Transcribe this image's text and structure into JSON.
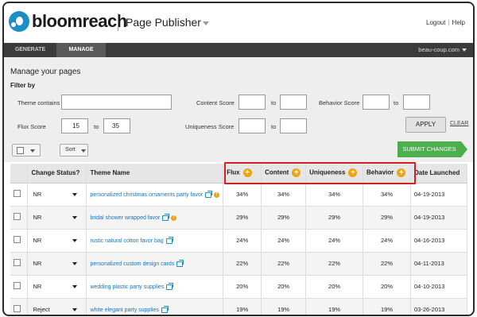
{
  "brand": {
    "name": "bloomreach",
    "app_title": "Page Publisher"
  },
  "toplinks": {
    "logout": "Logout",
    "help": "Help",
    "separator": "|"
  },
  "nav": {
    "tabs": [
      {
        "label": "GENERATE"
      },
      {
        "label": "MANAGE"
      }
    ],
    "site": "beau-coup.com"
  },
  "filter": {
    "heading": "Manage your pages",
    "title": "Filter by",
    "theme_contains": {
      "label": "Theme contains",
      "value": ""
    },
    "content_score": {
      "label": "Content Score",
      "from": "",
      "to": ""
    },
    "behavior_score": {
      "label": "Behavior Score",
      "from": "",
      "to": ""
    },
    "flux_score": {
      "label": "Flux Score",
      "from": "15",
      "to": "35"
    },
    "uniqueness_score": {
      "label": "Uniqueness Score",
      "from": "",
      "to": ""
    },
    "to_label": "to",
    "apply": "APPLY",
    "clear": "CLEAR"
  },
  "toolbar": {
    "sort": "Sort",
    "submit": "SUBMIT CHANGES"
  },
  "table": {
    "headers": {
      "change_status": "Change Status?",
      "theme_name": "Theme Name",
      "flux": "Flux",
      "content": "Content",
      "uniqueness": "Uniqueness",
      "behavior": "Behavior",
      "date_launched": "Date Launched"
    },
    "rows": [
      {
        "status": "NR",
        "theme": "personalized christmas ornaments party favor",
        "warn": true,
        "flux": "34%",
        "content": "34%",
        "uniqueness": "34%",
        "behavior": "34%",
        "date": "04-19-2013"
      },
      {
        "status": "NR",
        "theme": "bridal shower wrapped favor",
        "warn": true,
        "flux": "29%",
        "content": "29%",
        "uniqueness": "29%",
        "behavior": "29%",
        "date": "04-19-2013"
      },
      {
        "status": "NR",
        "theme": "rustic natural cotton favor bag",
        "warn": false,
        "flux": "24%",
        "content": "24%",
        "uniqueness": "24%",
        "behavior": "24%",
        "date": "04-16-2013"
      },
      {
        "status": "NR",
        "theme": "personalized custom  design cards",
        "warn": false,
        "flux": "22%",
        "content": "22%",
        "uniqueness": "22%",
        "behavior": "22%",
        "date": "04-11-2013"
      },
      {
        "status": "NR",
        "theme": "wedding plastic party supplies",
        "warn": false,
        "flux": "20%",
        "content": "20%",
        "uniqueness": "20%",
        "behavior": "20%",
        "date": "04-10-2013"
      },
      {
        "status": "Reject",
        "theme": "white elegant party supplies",
        "warn": false,
        "flux": "19%",
        "content": "19%",
        "uniqueness": "19%",
        "behavior": "19%",
        "date": "03-26-2013"
      }
    ]
  },
  "colors": {
    "brand_blue": "#1b8ec5",
    "nav_dark": "#3b3b3b",
    "submit_green": "#4cae4c",
    "highlight_red": "#d62020",
    "plus_orange": "#f0a30a"
  }
}
